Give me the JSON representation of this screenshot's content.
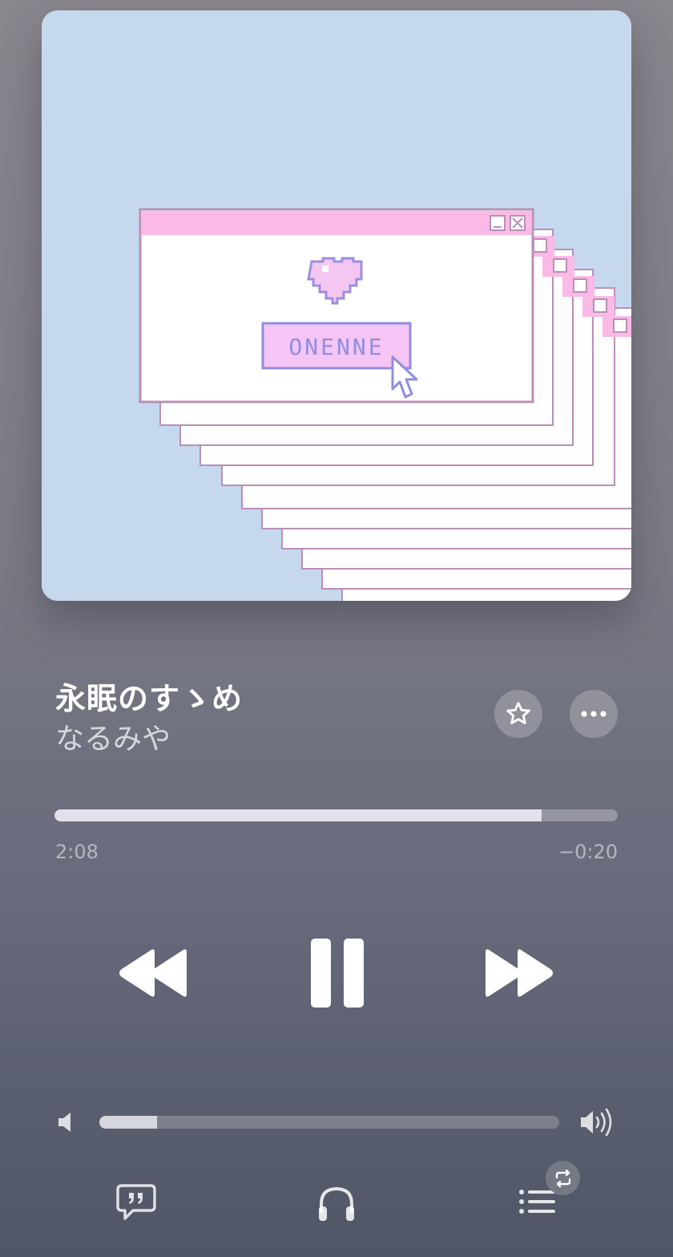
{
  "artwork": {
    "button_text": "ONENNE",
    "colors": {
      "background": "#c6d8ee",
      "window_title": "#fbb9e6",
      "window_body": "#ffffff",
      "accent": "#8f8ee0"
    }
  },
  "track": {
    "title": "永眠のすゝめ",
    "artist": "なるみや"
  },
  "progress": {
    "elapsed": "2:08",
    "remaining": "−0:20",
    "fraction": 0.865
  },
  "volume": {
    "fraction": 0.125
  },
  "icons": {
    "favorite": "star-icon",
    "more": "ellipsis-icon",
    "rewind": "rewind-icon",
    "pause": "pause-icon",
    "forward": "fast-forward-icon",
    "volume_min": "speaker-icon",
    "volume_max": "speaker-wave-icon",
    "lyrics": "lyrics-quote-icon",
    "airplay": "headphones-icon",
    "queue": "list-icon",
    "repeat": "repeat-icon"
  },
  "colors": {
    "accent": "#ffffff",
    "muted_text": "rgba(255,255,255,0.5)"
  }
}
